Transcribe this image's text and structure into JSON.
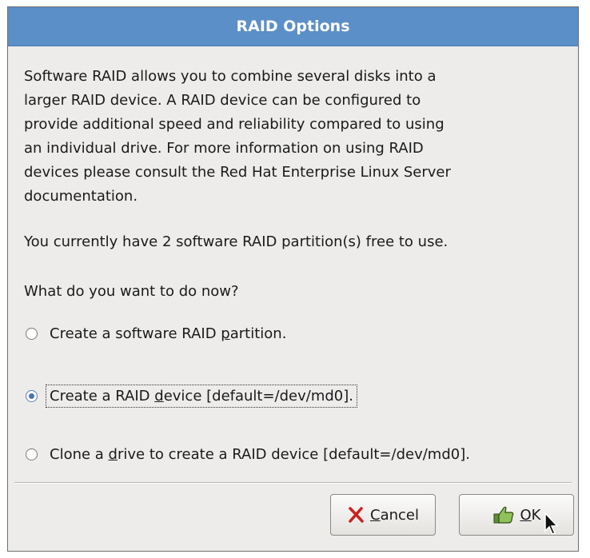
{
  "dialog": {
    "title": "RAID Options",
    "intro_lines": [
      "Software RAID allows you to combine several disks into a",
      "larger RAID device.  A RAID device can be configured to",
      "provide additional speed and reliability compared to using",
      "an individual drive.  For more information on using RAID",
      "devices please consult the Red Hat Enterprise Linux Server",
      "documentation."
    ],
    "free_text": "You currently have 2 software RAID partition(s) free to use.",
    "question": "What do you want to do now?",
    "options": [
      {
        "pre": "Create a software RAID ",
        "mnemonic": "p",
        "post": "artition.",
        "selected": false
      },
      {
        "pre": "Create a RAID ",
        "mnemonic": "d",
        "post": "evice [default=/dev/md0].",
        "selected": true
      },
      {
        "pre": "Clone a ",
        "mnemonic": "d",
        "post": "rive to create a RAID device [default=/dev/md0].",
        "selected": false
      }
    ],
    "buttons": {
      "cancel": {
        "mnemonic": "C",
        "rest": "ancel",
        "icon": "cancel-x-icon"
      },
      "ok": {
        "mnemonic": "O",
        "rest": "K",
        "icon": "ok-thumb-icon"
      }
    }
  },
  "colors": {
    "titlebar": "#5b8fc8",
    "dialog_bg": "#edeceb",
    "radio_selected": "#4a74ad",
    "cancel_icon": "#cc1f1f",
    "ok_icon": "#6a9a3c"
  }
}
